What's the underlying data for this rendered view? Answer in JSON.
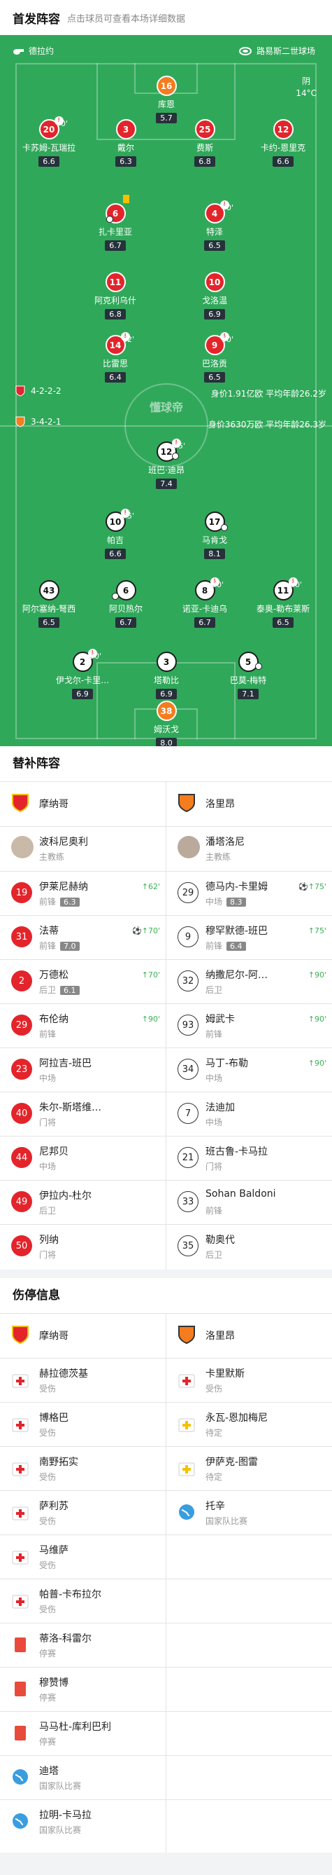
{
  "header": {
    "title": "首发阵容",
    "subtitle": "点击球员可查看本场详细数据"
  },
  "match": {
    "referee": "德拉约",
    "venue": "路易斯二世球场",
    "weather": "阴",
    "temp": "14°C",
    "watermark": "懂球帝"
  },
  "home": {
    "name": "摩纳哥",
    "formation": "4-2-2-2",
    "value": "身价1.91亿欧",
    "age": "平均年龄26.2岁"
  },
  "away": {
    "name": "洛里昂",
    "formation": "3-4-2-1",
    "value": "身价3630万欧",
    "age": "平均年龄26.3岁"
  },
  "pitch_home": [
    {
      "num": "16",
      "name": "库恩",
      "rating": "5.7",
      "color": "org"
    },
    {
      "num": "20",
      "name": "卡苏姆-瓦瑞拉",
      "rating": "6.6",
      "sub": "70'",
      "color": "red"
    },
    {
      "num": "3",
      "name": "戴尔",
      "rating": "6.3",
      "color": "red"
    },
    {
      "num": "25",
      "name": "费斯",
      "rating": "6.8",
      "color": "red"
    },
    {
      "num": "12",
      "name": "卡约-恩里克",
      "rating": "6.6",
      "color": "red"
    },
    {
      "num": "6",
      "name": "扎卡里亚",
      "rating": "6.7",
      "color": "red"
    },
    {
      "num": "4",
      "name": "特泽",
      "rating": "6.5",
      "sub": "70'",
      "color": "red"
    },
    {
      "num": "11",
      "name": "阿克利乌什",
      "rating": "6.8",
      "color": "red"
    },
    {
      "num": "10",
      "name": "戈洛温",
      "rating": "6.9",
      "color": "red"
    },
    {
      "num": "14",
      "name": "比雷思",
      "rating": "6.4",
      "sub": "62'",
      "color": "red"
    },
    {
      "num": "9",
      "name": "巴洛贡",
      "rating": "6.5",
      "sub": "90'",
      "color": "red"
    }
  ],
  "pitch_away": [
    {
      "num": "12",
      "name": "班巴·迪昂",
      "rating": "7.4",
      "sub": "75'",
      "color": "wht"
    },
    {
      "num": "10",
      "name": "帕吉",
      "rating": "6.6",
      "sub": "75'",
      "color": "wht"
    },
    {
      "num": "17",
      "name": "马肯戈",
      "rating": "8.1",
      "color": "wht"
    },
    {
      "num": "43",
      "name": "阿尔塞纳-弩西",
      "rating": "6.5",
      "color": "wht"
    },
    {
      "num": "6",
      "name": "阿贝热尔",
      "rating": "6.7",
      "color": "wht"
    },
    {
      "num": "8",
      "name": "诺亚-卡迪乌",
      "rating": "6.7",
      "sub": "90'",
      "color": "wht"
    },
    {
      "num": "11",
      "name": "泰奥-勒布莱斯",
      "rating": "6.5",
      "sub": "90'",
      "color": "wht"
    },
    {
      "num": "2",
      "name": "伊戈尔-卡里…",
      "rating": "6.9",
      "sub": "90'",
      "color": "wht"
    },
    {
      "num": "3",
      "name": "塔勒比",
      "rating": "6.9",
      "color": "wht"
    },
    {
      "num": "5",
      "name": "巴莫-梅特",
      "rating": "7.1",
      "color": "wht"
    },
    {
      "num": "38",
      "name": "姆沃戈",
      "rating": "8.0",
      "color": "org"
    }
  ],
  "subs": {
    "title": "替补阵容",
    "home_coach": {
      "name": "波科尼奥利",
      "role": "主教练"
    },
    "away_coach": {
      "name": "潘塔洛尼",
      "role": "主教练"
    },
    "home": [
      {
        "num": "19",
        "name": "伊莱尼赫纳",
        "pos": "前锋",
        "rating": "6.3",
        "event": "↑62'",
        "color": "red"
      },
      {
        "num": "31",
        "name": "法蒂",
        "pos": "前锋",
        "rating": "7.0",
        "event": "⚽↑70'",
        "color": "red"
      },
      {
        "num": "2",
        "name": "万德松",
        "pos": "后卫",
        "rating": "6.1",
        "event": "↑70'",
        "color": "red"
      },
      {
        "num": "29",
        "name": "布伦纳",
        "pos": "前锋",
        "rating": "",
        "event": "↑90'",
        "color": "red"
      },
      {
        "num": "23",
        "name": "阿拉吉-班巴",
        "pos": "中场",
        "rating": "",
        "event": "",
        "color": "red"
      },
      {
        "num": "40",
        "name": "朱尔-斯塔维…",
        "pos": "门将",
        "rating": "",
        "event": "",
        "color": "red"
      },
      {
        "num": "44",
        "name": "尼邦贝",
        "pos": "中场",
        "rating": "",
        "event": "",
        "color": "red"
      },
      {
        "num": "49",
        "name": "伊拉内-杜尔",
        "pos": "后卫",
        "rating": "",
        "event": "",
        "color": "red"
      },
      {
        "num": "50",
        "name": "列纳",
        "pos": "门将",
        "rating": "",
        "event": "",
        "color": "red"
      }
    ],
    "away": [
      {
        "num": "29",
        "name": "德马内-卡里姆",
        "pos": "中场",
        "rating": "8.3",
        "event": "⚽↑75'",
        "color": "wht"
      },
      {
        "num": "9",
        "name": "穆罕默德-班巴",
        "pos": "前锋",
        "rating": "6.4",
        "event": "↑75'",
        "color": "wht"
      },
      {
        "num": "32",
        "name": "纳撒尼尔-阿…",
        "pos": "后卫",
        "rating": "",
        "event": "↑90'",
        "color": "wht"
      },
      {
        "num": "93",
        "name": "姆武卡",
        "pos": "前锋",
        "rating": "",
        "event": "↑90'",
        "color": "wht"
      },
      {
        "num": "34",
        "name": "马丁-布勒",
        "pos": "中场",
        "rating": "",
        "event": "↑90'",
        "color": "wht"
      },
      {
        "num": "7",
        "name": "法迪加",
        "pos": "中场",
        "rating": "",
        "event": "",
        "color": "wht"
      },
      {
        "num": "21",
        "name": "班古鲁-卡马拉",
        "pos": "门将",
        "rating": "",
        "event": "",
        "color": "wht"
      },
      {
        "num": "33",
        "name": "Sohan Baldoni",
        "pos": "前锋",
        "rating": "",
        "event": "",
        "color": "wht"
      },
      {
        "num": "35",
        "name": "勒奥代",
        "pos": "后卫",
        "rating": "",
        "event": "",
        "color": "wht"
      }
    ]
  },
  "injuries": {
    "title": "伤停信息",
    "home": [
      {
        "name": "赫拉德茨基",
        "status": "受伤",
        "icon": "injury"
      },
      {
        "name": "博格巴",
        "status": "受伤",
        "icon": "injury"
      },
      {
        "name": "南野拓实",
        "status": "受伤",
        "icon": "injury"
      },
      {
        "name": "萨利苏",
        "status": "受伤",
        "icon": "injury"
      },
      {
        "name": "马维萨",
        "status": "受伤",
        "icon": "injury"
      },
      {
        "name": "帕普-卡布拉尔",
        "status": "受伤",
        "icon": "injury"
      },
      {
        "name": "蒂洛-科雷尔",
        "status": "停赛",
        "icon": "red-card"
      },
      {
        "name": "穆赞博",
        "status": "停赛",
        "icon": "red-card"
      },
      {
        "name": "马马杜-库利巴利",
        "status": "停赛",
        "icon": "red-card"
      },
      {
        "name": "迪塔",
        "status": "国家队比赛",
        "icon": "globe"
      },
      {
        "name": "拉明-卡马拉",
        "status": "国家队比赛",
        "icon": "globe"
      }
    ],
    "away": [
      {
        "name": "卡里默斯",
        "status": "受伤",
        "icon": "injury"
      },
      {
        "name": "永瓦-恩加梅尼",
        "status": "待定",
        "icon": "doubt"
      },
      {
        "name": "伊萨克-图雷",
        "status": "待定",
        "icon": "doubt"
      },
      {
        "name": "托辛",
        "status": "国家队比赛",
        "icon": "globe"
      }
    ]
  },
  "colors": {
    "pitch": "#30a85a",
    "home": "#e3242b",
    "keeper": "#f57c1f",
    "rating": "#27313b",
    "sub": "#3cb054"
  }
}
